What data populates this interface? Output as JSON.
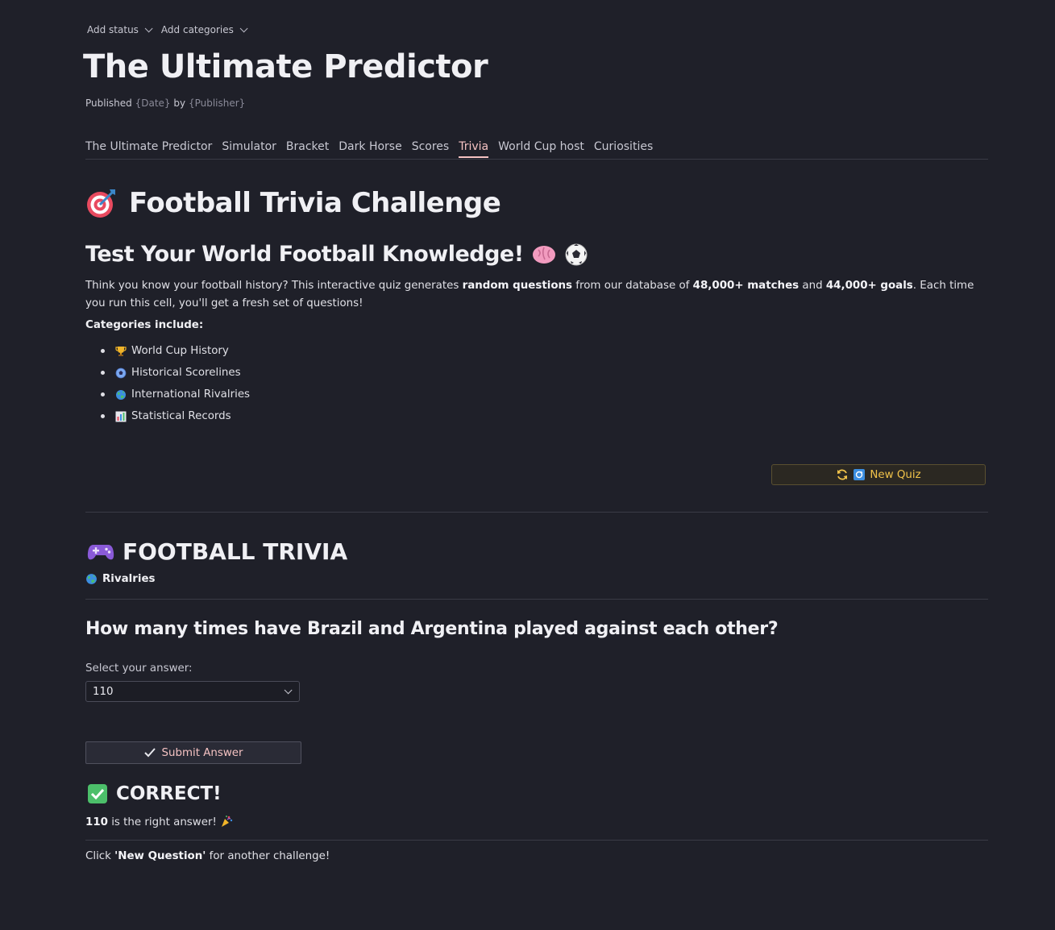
{
  "meta": {
    "add_status": "Add status",
    "add_categories": "Add categories"
  },
  "page": {
    "title": "The Ultimate Predictor",
    "published_prefix": "Published",
    "published_date": "{Date}",
    "published_by": "by",
    "published_publisher": "{Publisher}"
  },
  "tabs": [
    {
      "label": "The Ultimate Predictor",
      "active": false
    },
    {
      "label": "Simulator",
      "active": false
    },
    {
      "label": "Bracket",
      "active": false
    },
    {
      "label": "Dark Horse",
      "active": false
    },
    {
      "label": "Scores",
      "active": false
    },
    {
      "label": "Trivia",
      "active": true
    },
    {
      "label": "World Cup host",
      "active": false
    },
    {
      "label": "Curiosities",
      "active": false
    }
  ],
  "intro": {
    "heading": "Football Trivia Challenge",
    "subheading": "Test Your World Football Knowledge!",
    "p1": "Think you know your football history? This interactive quiz generates ",
    "p1_bold1": "random questions",
    "p2": " from our database of ",
    "p2_bold2": "48,000+ matches",
    "p3": " and ",
    "p3_bold3": "44,000+ goals",
    "p4": ". Each time you run this cell, you'll get a fresh set of questions!",
    "categories_heading": "Categories include:",
    "categories": [
      {
        "icon": "trophy-icon",
        "label": "World Cup History"
      },
      {
        "icon": "soccer-ball-icon",
        "label": "Historical Scorelines"
      },
      {
        "icon": "globe-icon",
        "label": "International Rivalries"
      },
      {
        "icon": "bar-chart-icon",
        "label": "Statistical Records"
      }
    ]
  },
  "new_quiz_button": "New Quiz",
  "quiz": {
    "title": "FOOTBALL TRIVIA",
    "category": "Rivalries",
    "question": "How many times have Brazil and Argentina played against each other?",
    "select_label": "Select your answer:",
    "selected_value": "110",
    "submit_label": "Submit Answer",
    "result_title": "CORRECT!",
    "result_value": "110",
    "result_text": " is the right answer!",
    "note_prefix": "Click ",
    "note_bold": "'New Question'",
    "note_suffix": " for another challenge!"
  },
  "colors": {
    "background": "#1f2029",
    "accent_tab": "#f4c2c2",
    "new_quiz_text": "#f0c24a"
  }
}
